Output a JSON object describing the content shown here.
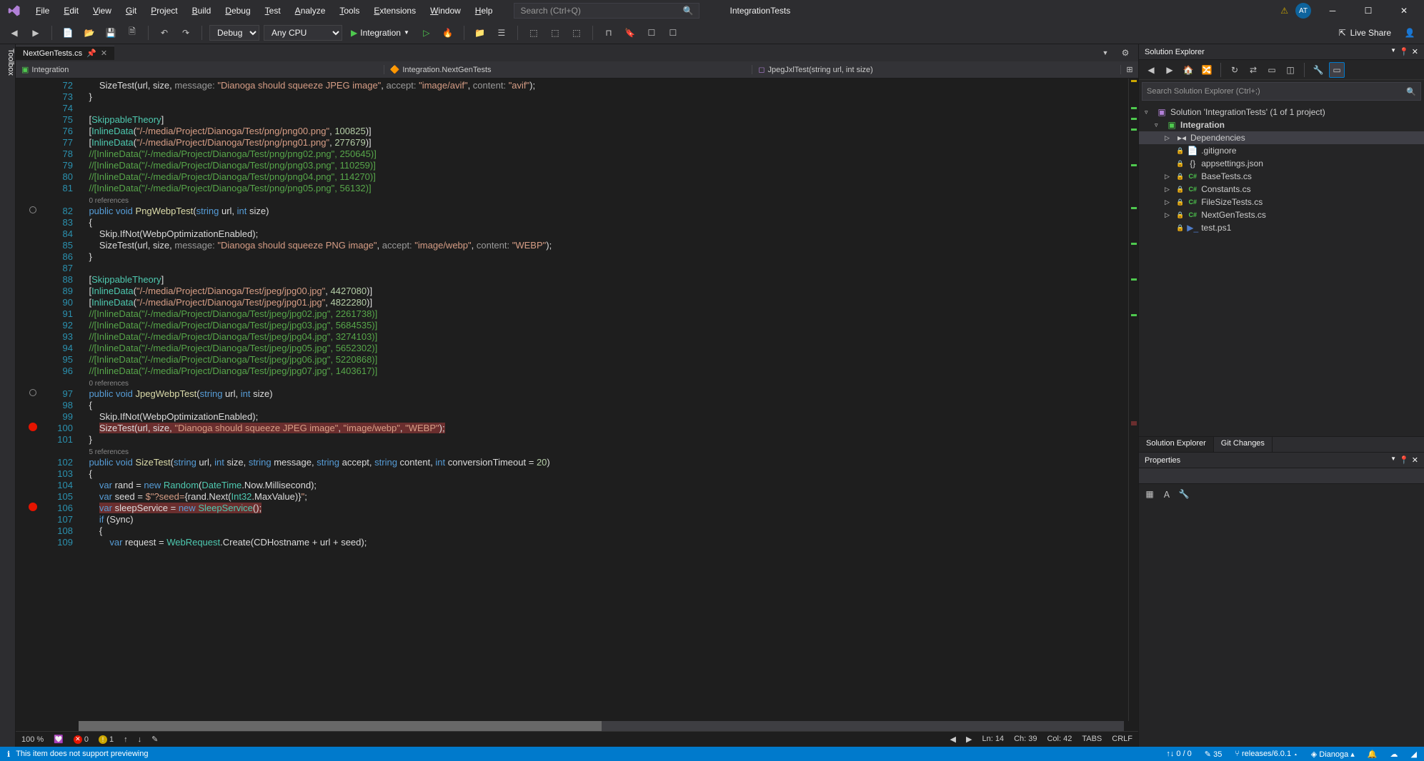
{
  "menubar": {
    "items": [
      "File",
      "Edit",
      "View",
      "Git",
      "Project",
      "Build",
      "Debug",
      "Test",
      "Analyze",
      "Tools",
      "Extensions",
      "Window",
      "Help"
    ],
    "search_placeholder": "Search (Ctrl+Q)",
    "project_name": "IntegrationTests",
    "avatar": "AT"
  },
  "toolbar": {
    "config": "Debug",
    "platform": "Any CPU",
    "run_target": "Integration",
    "live_share": "Live Share"
  },
  "toolbox_label": "Toolbox",
  "tabs": {
    "active": "NextGenTests.cs"
  },
  "breadcrumb": {
    "seg1": "Integration",
    "seg2": "Integration.NextGenTests",
    "seg3": "JpegJxlTest(string url, int size)"
  },
  "code": {
    "first_line_no": 72,
    "lines": [
      {
        "n": 72,
        "html": "        SizeTest(url, size, <span class='k-gray'>message:</span> <span class='k-str'>\"Dianoga should squeeze JPEG image\"</span>, <span class='k-gray'>accept:</span> <span class='k-str'>\"image/avif\"</span>, <span class='k-gray'>content:</span> <span class='k-str'>\"avif\"</span>);"
      },
      {
        "n": 73,
        "html": "    }"
      },
      {
        "n": 74,
        "html": ""
      },
      {
        "n": 75,
        "html": "    [<span class='k-type'>SkippableTheory</span>]"
      },
      {
        "n": 76,
        "html": "    [<span class='k-type'>InlineData</span>(<span class='k-str'>\"/-/media/Project/Dianoga/Test/png/png00.png\"</span>, <span class='k-num'>100825</span>)]"
      },
      {
        "n": 77,
        "html": "    [<span class='k-type'>InlineData</span>(<span class='k-str'>\"/-/media/Project/Dianoga/Test/png/png01.png\"</span>, <span class='k-num'>277679</span>)]"
      },
      {
        "n": 78,
        "html": "    <span class='k-green'>//[InlineData(\"/-/media/Project/Dianoga/Test/png/png02.png\", 250645)]</span>"
      },
      {
        "n": 79,
        "html": "    <span class='k-green'>//[InlineData(\"/-/media/Project/Dianoga/Test/png/png03.png\", 110259)]</span>"
      },
      {
        "n": 80,
        "html": "    <span class='k-green'>//[InlineData(\"/-/media/Project/Dianoga/Test/png/png04.png\", 114270)]</span>"
      },
      {
        "n": 81,
        "html": "    <span class='k-green'>//[InlineData(\"/-/media/Project/Dianoga/Test/png/png05.png\", 56132)]</span>"
      },
      {
        "n": null,
        "html": "    <span class='codelens'>0 references</span>"
      },
      {
        "n": 82,
        "html": "    <span class='k-blue'>public</span> <span class='k-blue'>void</span> <span class='k-method'>PngWebpTest</span>(<span class='k-blue'>string</span> url, <span class='k-blue'>int</span> size)",
        "glyph": "test"
      },
      {
        "n": 83,
        "html": "    {"
      },
      {
        "n": 84,
        "html": "        Skip.IfNot(WebpOptimizationEnabled);"
      },
      {
        "n": 85,
        "html": "        SizeTest(url, size, <span class='k-gray'>message:</span> <span class='k-str'>\"Dianoga should squeeze PNG image\"</span>, <span class='k-gray'>accept:</span> <span class='k-str'>\"image/webp\"</span>, <span class='k-gray'>content:</span> <span class='k-str'>\"WEBP\"</span>);"
      },
      {
        "n": 86,
        "html": "    }"
      },
      {
        "n": 87,
        "html": ""
      },
      {
        "n": 88,
        "html": "    [<span class='k-type'>SkippableTheory</span>]"
      },
      {
        "n": 89,
        "html": "    [<span class='k-type'>InlineData</span>(<span class='k-str'>\"/-/media/Project/Dianoga/Test/jpeg/jpg00.jpg\"</span>, <span class='k-num'>4427080</span>)]"
      },
      {
        "n": 90,
        "html": "    [<span class='k-type'>InlineData</span>(<span class='k-str'>\"/-/media/Project/Dianoga/Test/jpeg/jpg01.jpg\"</span>, <span class='k-num'>4822280</span>)]"
      },
      {
        "n": 91,
        "html": "    <span class='k-green'>//[InlineData(\"/-/media/Project/Dianoga/Test/jpeg/jpg02.jpg\", 2261738)]</span>"
      },
      {
        "n": 92,
        "html": "    <span class='k-green'>//[InlineData(\"/-/media/Project/Dianoga/Test/jpeg/jpg03.jpg\", 5684535)]</span>"
      },
      {
        "n": 93,
        "html": "    <span class='k-green'>//[InlineData(\"/-/media/Project/Dianoga/Test/jpeg/jpg04.jpg\", 3274103)]</span>"
      },
      {
        "n": 94,
        "html": "    <span class='k-green'>//[InlineData(\"/-/media/Project/Dianoga/Test/jpeg/jpg05.jpg\", 5652302)]</span>"
      },
      {
        "n": 95,
        "html": "    <span class='k-green'>//[InlineData(\"/-/media/Project/Dianoga/Test/jpeg/jpg06.jpg\", 5220868)]</span>"
      },
      {
        "n": 96,
        "html": "    <span class='k-green'>//[InlineData(\"/-/media/Project/Dianoga/Test/jpeg/jpg07.jpg\", 1403617)]</span>"
      },
      {
        "n": null,
        "html": "    <span class='codelens'>0 references</span>"
      },
      {
        "n": 97,
        "html": "    <span class='k-blue'>public</span> <span class='k-blue'>void</span> <span class='k-method'>JpegWebpTest</span>(<span class='k-blue'>string</span> url, <span class='k-blue'>int</span> size)",
        "glyph": "test"
      },
      {
        "n": 98,
        "html": "    {"
      },
      {
        "n": 99,
        "html": "        Skip.IfNot(WebpOptimizationEnabled);"
      },
      {
        "n": 100,
        "html": "        <span class='bp-line'>SizeTest(url, size, <span class='k-str'>\"Dianoga should squeeze JPEG image\"</span>, <span class='k-str'>\"image/webp\"</span>, <span class='k-str'>\"WEBP\"</span>);</span>",
        "glyph": "bp"
      },
      {
        "n": 101,
        "html": "    }"
      },
      {
        "n": null,
        "html": "    <span class='codelens'>5 references</span>"
      },
      {
        "n": 102,
        "html": "    <span class='k-blue'>public</span> <span class='k-blue'>void</span> <span class='k-method'>SizeTest</span>(<span class='k-blue'>string</span> url, <span class='k-blue'>int</span> size, <span class='k-blue'>string</span> message, <span class='k-blue'>string</span> accept, <span class='k-blue'>string</span> content, <span class='k-blue'>int</span> conversionTimeout = <span class='k-num'>20</span>)"
      },
      {
        "n": 103,
        "html": "    {"
      },
      {
        "n": 104,
        "html": "        <span class='k-blue'>var</span> rand = <span class='k-blue'>new</span> <span class='k-type'>Random</span>(<span class='k-type'>DateTime</span>.Now.Millisecond);"
      },
      {
        "n": 105,
        "html": "        <span class='k-blue'>var</span> seed = <span class='k-str'>$\"?seed=</span>{rand.Next(<span class='k-type'>Int32</span>.MaxValue)}<span class='k-str'>\"</span>;"
      },
      {
        "n": 106,
        "html": "        <span class='bp-line'><span class='k-blue'>var</span> sleepService = <span class='k-blue'>new</span> <span class='k-type'>SleepService</span>();</span>",
        "glyph": "bp"
      },
      {
        "n": 107,
        "html": "        <span class='k-blue'>if</span> (Sync)"
      },
      {
        "n": 108,
        "html": "        {"
      },
      {
        "n": 109,
        "html": "            <span class='k-blue'>var</span> request = <span class='k-type'>WebRequest</span>.Create(CDHostname + url + seed);"
      }
    ]
  },
  "editor_status": {
    "zoom": "100 %",
    "errors": "0",
    "warnings": "1",
    "ln": "Ln: 14",
    "ch": "Ch: 39",
    "col": "Col: 42",
    "tabs": "TABS",
    "crlf": "CRLF"
  },
  "solution_explorer": {
    "title": "Solution Explorer",
    "search_placeholder": "Search Solution Explorer (Ctrl+;)",
    "solution": "Solution 'IntegrationTests' (1 of 1 project)",
    "project": "Integration",
    "items": [
      {
        "label": "Dependencies",
        "indent": 3,
        "arrow": "▷",
        "icon": "dep"
      },
      {
        "label": ".gitignore",
        "indent": 3,
        "icon": "file",
        "lock": true
      },
      {
        "label": "appsettings.json",
        "indent": 3,
        "icon": "json",
        "lock": true
      },
      {
        "label": "BaseTests.cs",
        "indent": 3,
        "arrow": "▷",
        "icon": "cs",
        "lock": true
      },
      {
        "label": "Constants.cs",
        "indent": 3,
        "arrow": "▷",
        "icon": "cs",
        "lock": true
      },
      {
        "label": "FileSizeTests.cs",
        "indent": 3,
        "arrow": "▷",
        "icon": "cs",
        "lock": true
      },
      {
        "label": "NextGenTests.cs",
        "indent": 3,
        "arrow": "▷",
        "icon": "cs",
        "lock": true
      },
      {
        "label": "test.ps1",
        "indent": 3,
        "icon": "ps",
        "lock": true
      }
    ],
    "tabs": [
      "Solution Explorer",
      "Git Changes"
    ]
  },
  "properties": {
    "title": "Properties"
  },
  "statusbar": {
    "message": "This item does not support previewing",
    "changes": "0 / 0",
    "commits": "35",
    "branch": "releases/6.0.1",
    "repo": "Dianoga"
  }
}
